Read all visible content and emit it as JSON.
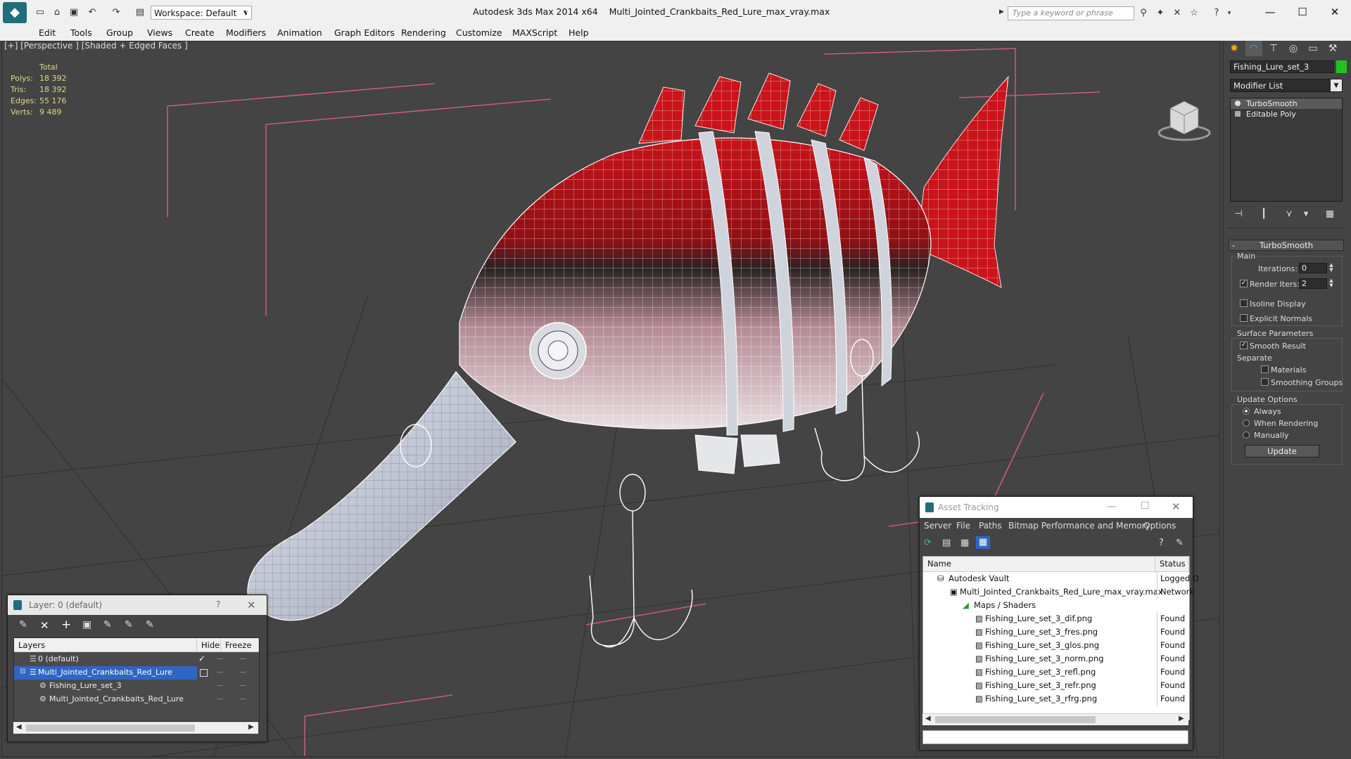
{
  "app": {
    "title": "Autodesk 3ds Max  2014 x64",
    "filename": "Multi_Jointed_Crankbaits_Red_Lure_max_vray.max",
    "workspace": "Workspace: Default",
    "search_placeholder": "Type a keyword or phrase"
  },
  "menu": [
    "Edit",
    "Tools",
    "Group",
    "Views",
    "Create",
    "Modifiers",
    "Animation",
    "Graph Editors",
    "Rendering",
    "Customize",
    "MAXScript",
    "Help"
  ],
  "viewport": {
    "label": "[+] [Perspective ] [Shaded + Edged Faces ]",
    "stats": {
      "header": "Total",
      "rows": [
        {
          "label": "Polys:",
          "value": "18 392"
        },
        {
          "label": "Tris:",
          "value": "18 392"
        },
        {
          "label": "Edges:",
          "value": "55 176"
        },
        {
          "label": "Verts:",
          "value": "9 489"
        }
      ]
    }
  },
  "command_panel": {
    "object_name": "Fishing_Lure_set_3",
    "object_color": "#1fc41f",
    "modifier_list": "Modifier List",
    "stack": [
      "TurboSmooth",
      "Editable Poly"
    ],
    "turbosmooth": {
      "title": "TurboSmooth",
      "main": "Main",
      "iterations_label": "Iterations:",
      "iterations": "0",
      "render_iters_label": "Render Iters:",
      "render_iters": "2",
      "isoline": "Isoline Display",
      "explicit": "Explicit Normals",
      "surface": "Surface Parameters",
      "smooth_result": "Smooth Result",
      "separate": "Separate",
      "materials": "Materials",
      "smoothing_groups": "Smoothing Groups",
      "update_options": "Update Options",
      "always": "Always",
      "when_rendering": "When Rendering",
      "manually": "Manually",
      "update": "Update"
    }
  },
  "layer_window": {
    "title": "Layer: 0 (default)",
    "help": "?",
    "col_layers": "Layers",
    "col_hide": "Hide",
    "col_freeze": "Freeze",
    "rows": [
      "0 (default)",
      "Multi_Jointed_Crankbaits_Red_Lure",
      "Fishing_Lure_set_3",
      "Multi_Jointed_Crankbaits_Red_Lure"
    ]
  },
  "asset_window": {
    "title": "Asset Tracking",
    "menu": [
      "Server",
      "File",
      "Paths",
      "Bitmap Performance and Memory",
      "Options"
    ],
    "col_name": "Name",
    "col_status": "Status",
    "rows": [
      {
        "name": "Autodesk Vault",
        "status": "Logged O"
      },
      {
        "name": "Multi_Jointed_Crankbaits_Red_Lure_max_vray.max",
        "status": "Network"
      },
      {
        "name": "Maps / Shaders",
        "status": ""
      },
      {
        "name": "Fishing_Lure_set_3_dif.png",
        "status": "Found"
      },
      {
        "name": "Fishing_Lure_set_3_fres.png",
        "status": "Found"
      },
      {
        "name": "Fishing_Lure_set_3_glos.png",
        "status": "Found"
      },
      {
        "name": "Fishing_Lure_set_3_norm.png",
        "status": "Found"
      },
      {
        "name": "Fishing_Lure_set_3_refl.png",
        "status": "Found"
      },
      {
        "name": "Fishing_Lure_set_3_refr.png",
        "status": "Found"
      },
      {
        "name": "Fishing_Lure_set_3_rfrg.png",
        "status": "Found"
      }
    ]
  }
}
